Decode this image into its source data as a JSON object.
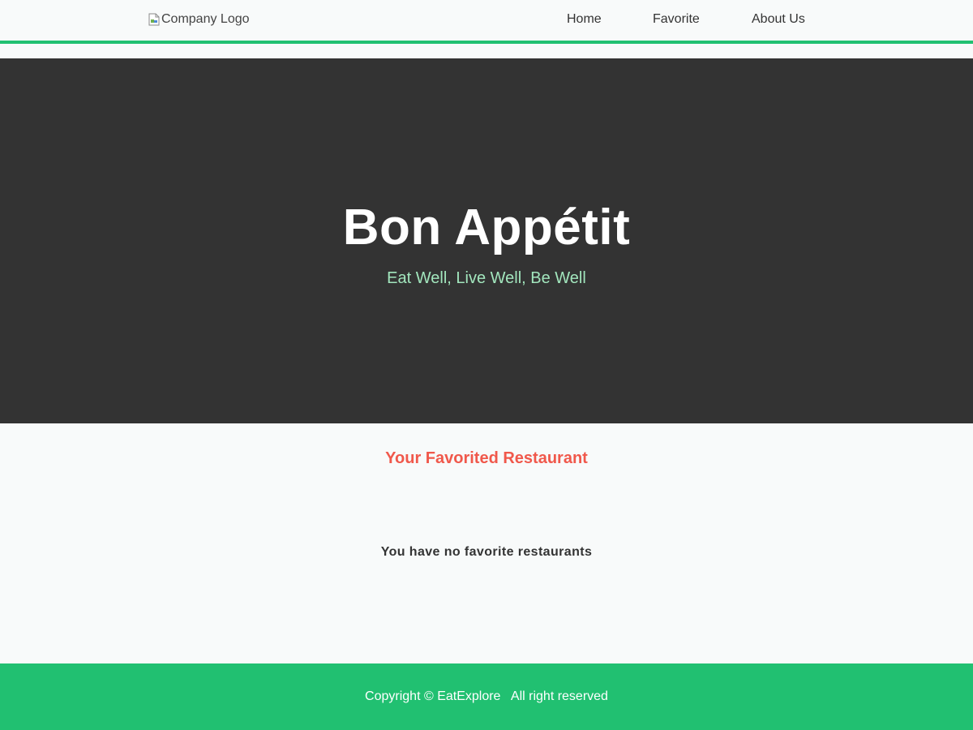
{
  "header": {
    "logo_alt": "Company Logo",
    "nav": {
      "home": "Home",
      "favorite": "Favorite",
      "about": "About Us"
    }
  },
  "hero": {
    "title": "Bon Appétit",
    "tagline": "Eat Well, Live Well, Be Well"
  },
  "main": {
    "heading": "Your Favorited Restaurant",
    "empty_message": "You have no favorite restaurants"
  },
  "footer": {
    "copyright": "Copyright © EatExplore   All right reserved"
  },
  "colors": {
    "accent_green": "#21c071",
    "hero_bg": "#333333",
    "tagline_green": "#a2e6bd",
    "heading_red": "#f0584b"
  }
}
